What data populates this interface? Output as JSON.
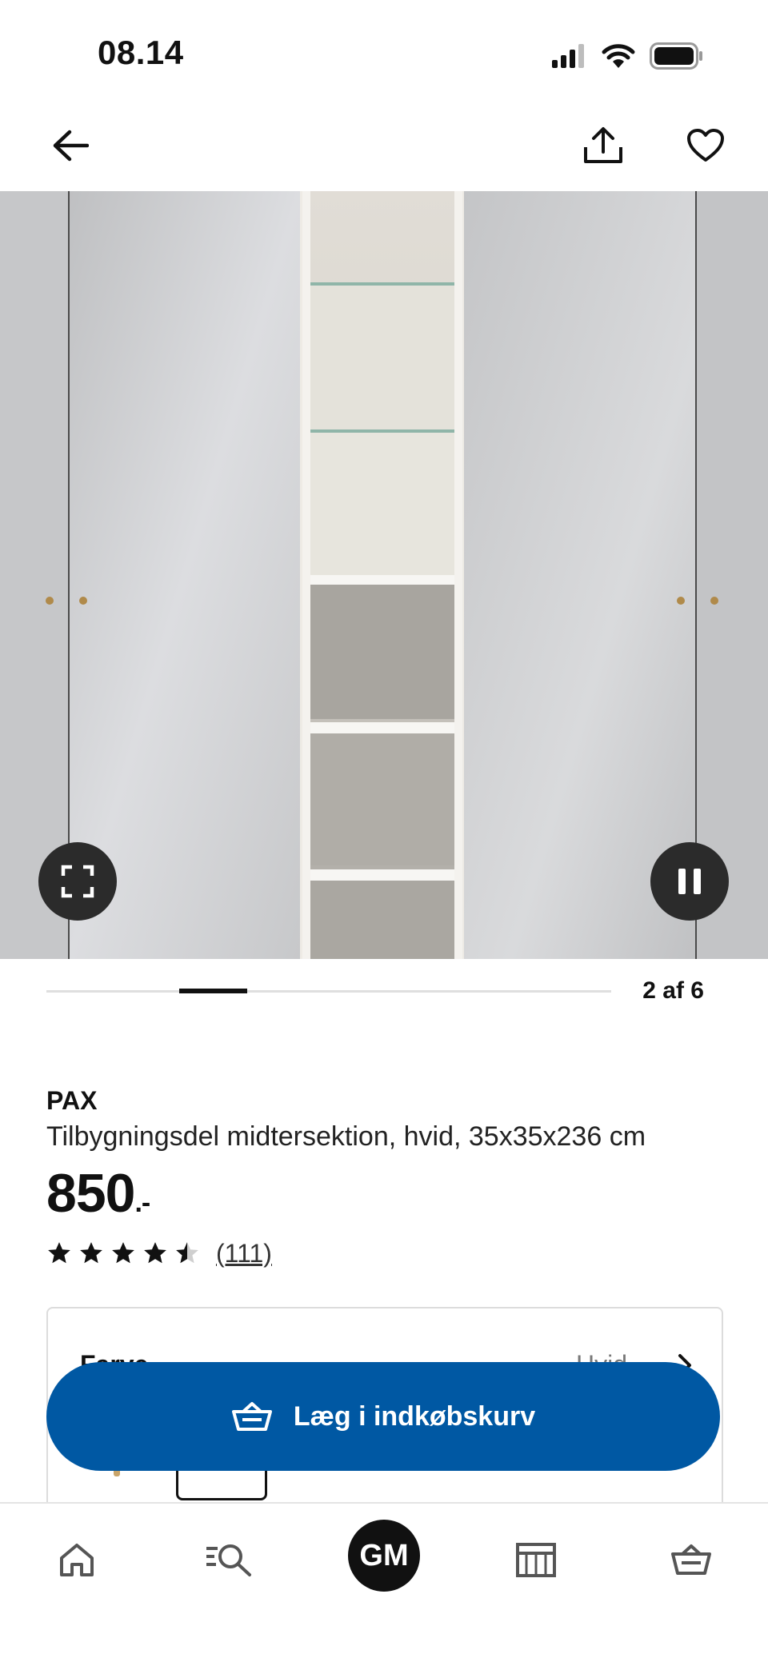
{
  "status_bar": {
    "time": "08.14"
  },
  "header": {
    "back_icon": "arrow-left-icon",
    "share_icon": "share-icon",
    "favorite_icon": "heart-icon"
  },
  "gallery": {
    "current": 2,
    "total": 6,
    "counter_text": "2 af 6",
    "fullscreen_icon": "fullscreen-icon",
    "pause_icon": "pause-icon"
  },
  "product": {
    "name": "PAX",
    "description": "Tilbygningsdel midtersektion, hvid, 35x35x236 cm",
    "price": "850",
    "price_suffix": ".-",
    "rating": 4.5,
    "rating_max": 5,
    "review_count": "(111)"
  },
  "color_selector": {
    "label": "Farve",
    "value": "Hvid"
  },
  "cta": {
    "label": "Læg i indkøbskurv",
    "icon": "basket-icon",
    "color": "#0058a3"
  },
  "bottom_nav": {
    "items": [
      {
        "icon": "home-icon"
      },
      {
        "icon": "search-icon"
      },
      {
        "avatar_initials": "GM"
      },
      {
        "icon": "store-icon"
      },
      {
        "icon": "cart-icon"
      }
    ]
  }
}
